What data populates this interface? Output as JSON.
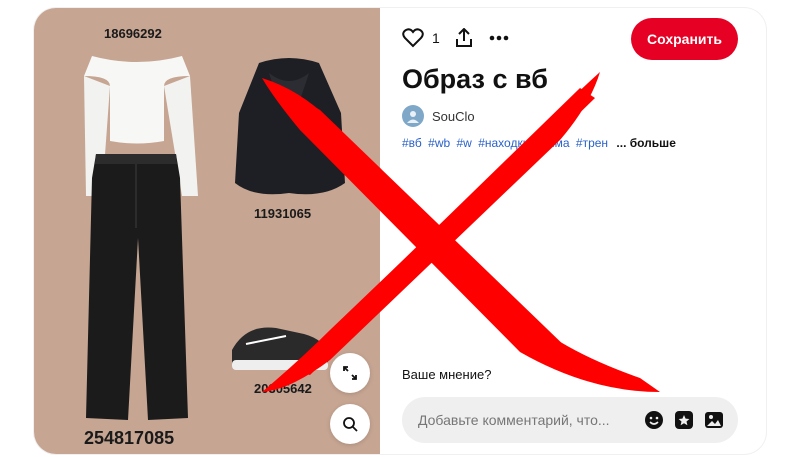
{
  "image": {
    "top_code": "18696292",
    "jacket_code": "11931065",
    "shoes_code": "20305642",
    "jeans_code": "254817085",
    "background_color": "#c6a592"
  },
  "toolbar": {
    "like_count": "1",
    "save_label": "Сохранить"
  },
  "pin": {
    "title": "Образ с вб",
    "author": "SouClo",
    "tags": [
      "#вб",
      "#wb",
      "#w",
      "#находки",
      "#зима",
      "#трен"
    ],
    "more_label": "... больше"
  },
  "comments": {
    "prompt": "Ваше мнение?",
    "placeholder": "Добавьте комментарий, что..."
  },
  "colors": {
    "accent": "#e60023",
    "tag": "#2a62c9",
    "cross": "#ff0000"
  }
}
